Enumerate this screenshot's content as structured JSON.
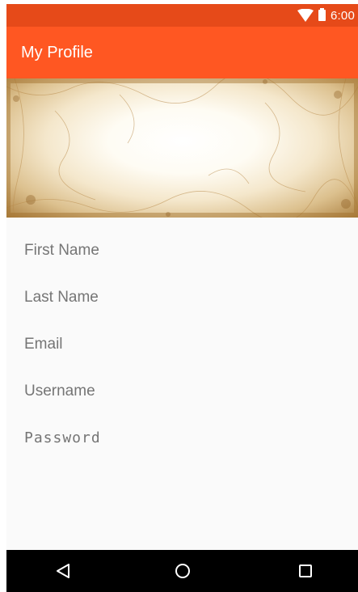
{
  "status_bar": {
    "time": "6:00",
    "icons": [
      "wifi-icon",
      "battery-icon"
    ],
    "color": "#e64a19"
  },
  "app_bar": {
    "title": "My Profile",
    "color": "#ff5722"
  },
  "form": {
    "first_name_placeholder": "First Name",
    "last_name_placeholder": "Last Name",
    "email_placeholder": "Email",
    "username_placeholder": "Username",
    "password_placeholder": "Password"
  },
  "nav_bar": {
    "icons": [
      "back-icon",
      "home-icon",
      "recents-icon"
    ]
  }
}
